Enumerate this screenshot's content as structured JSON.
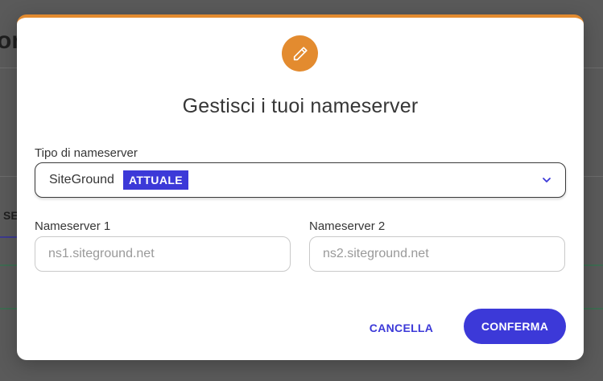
{
  "background": {
    "page_title_fragment": "or",
    "tab_fragment": "SE"
  },
  "modal": {
    "icon": "pencil-icon",
    "accent_color": "#e38b2f",
    "title": "Gestisci i tuoi nameserver",
    "nameserver_type": {
      "label": "Tipo di nameserver",
      "selected_value": "SiteGround",
      "badge": "ATTUALE",
      "icon": "chevron-down-icon"
    },
    "nameserver_1": {
      "label": "Nameserver 1",
      "placeholder": "ns1.siteground.net",
      "value": ""
    },
    "nameserver_2": {
      "label": "Nameserver 2",
      "placeholder": "ns2.siteground.net",
      "value": ""
    },
    "buttons": {
      "cancel": "CANCELLA",
      "confirm": "CONFERMA"
    },
    "primary_color": "#3c39d8"
  }
}
